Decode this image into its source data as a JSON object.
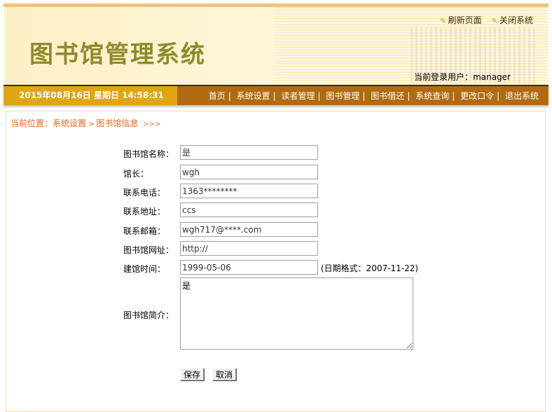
{
  "header": {
    "title": "图书馆管理系统",
    "refresh": "刷新页面",
    "close": "关闭系统",
    "current_user_label": "当前登录用户：",
    "current_user": "manager"
  },
  "nav": {
    "datetime": "2015年08月16日 星期日 14:58:31",
    "items": [
      "首页",
      "系统设置",
      "读者管理",
      "图书管理",
      "图书借还",
      "系统查询",
      "更改口令",
      "退出系统"
    ],
    "separator": "|"
  },
  "breadcrumb": {
    "prefix": "当前位置：",
    "section": "系统设置",
    "page": "图书馆信息",
    "sep": ">",
    "tail": ">>>"
  },
  "form": {
    "name_label": "图书馆名称：",
    "name": "是",
    "curator_label": "馆长：",
    "curator": "wgh",
    "phone_label": "联系电话：",
    "phone": "1363********",
    "address_label": "联系地址：",
    "address": "ccs",
    "email_label": "联系邮箱：",
    "email": "wgh717@****.com",
    "url_label": "图书馆网址：",
    "url": "http://",
    "founded_label": "建馆时间：",
    "founded": "1999-05-06",
    "founded_hint": "(日期格式：2007-11-22)",
    "intro_label": "图书馆简介：",
    "intro": "是",
    "save": "保存",
    "cancel": "取消"
  }
}
